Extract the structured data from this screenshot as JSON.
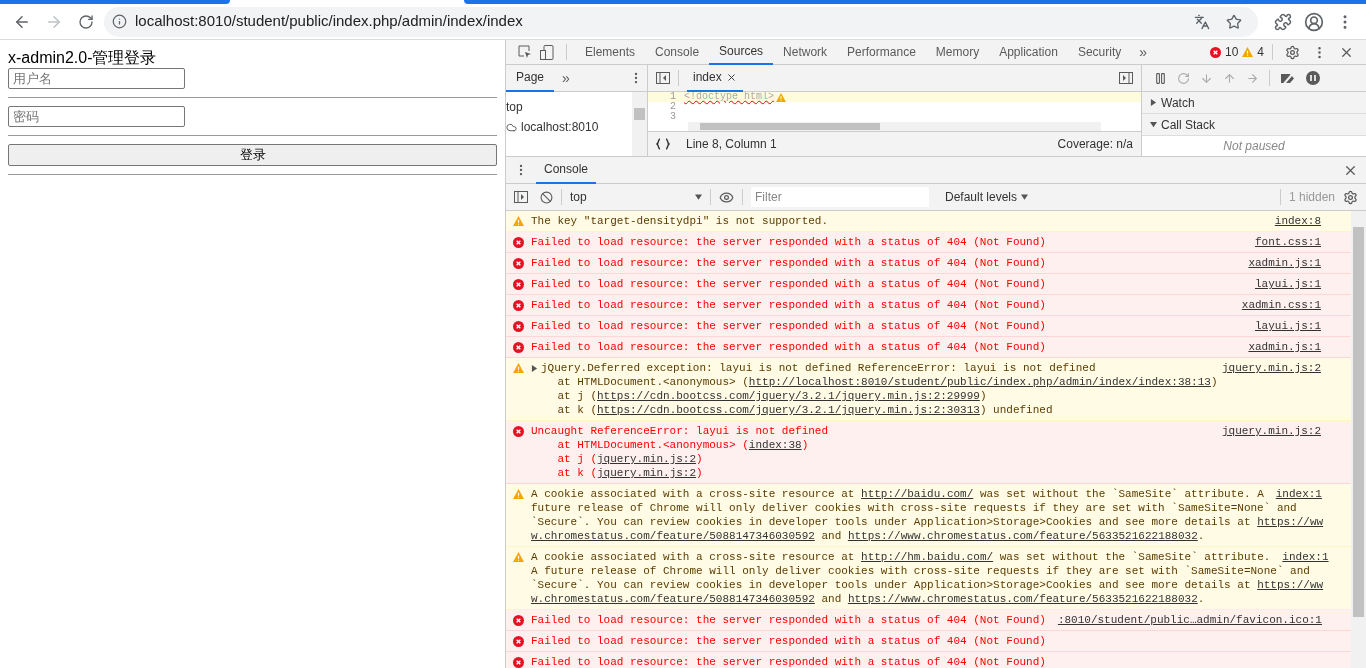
{
  "browser": {
    "url": "localhost:8010/student/public/index.php/admin/index/index",
    "forward_disabled": true
  },
  "page": {
    "title": "x-admin2.0-管理登录",
    "username_placeholder": "用户名",
    "password_placeholder": "密码",
    "login_button": "登录"
  },
  "devtools": {
    "tabs": [
      {
        "label": "Elements",
        "selected": false
      },
      {
        "label": "Console",
        "selected": false
      },
      {
        "label": "Sources",
        "selected": true
      },
      {
        "label": "Network",
        "selected": false
      },
      {
        "label": "Performance",
        "selected": false
      },
      {
        "label": "Memory",
        "selected": false
      },
      {
        "label": "Application",
        "selected": false
      },
      {
        "label": "Security",
        "selected": false
      }
    ],
    "more_tabs": "»",
    "error_count": "10",
    "warning_count": "4",
    "navigator": {
      "tabs": [
        {
          "label": "Page",
          "selected": true
        }
      ],
      "more": "»",
      "tree": [
        {
          "label": "top",
          "kind": "frame"
        },
        {
          "label": "localhost:8010",
          "kind": "origin"
        }
      ]
    },
    "editor": {
      "tabs": [
        {
          "label": "index",
          "selected": true
        }
      ],
      "lines": [
        {
          "number": "1",
          "code": "<!doctype html>",
          "warning": true
        },
        {
          "number": "2"
        },
        {
          "number": "3"
        }
      ],
      "status": "Line 8, Column 1",
      "coverage": "Coverage: n/a"
    },
    "debugger": {
      "sections": [
        {
          "label": "Watch",
          "expanded": false
        },
        {
          "label": "Call Stack",
          "expanded": true
        }
      ],
      "call_stack_text": "Not paused"
    },
    "drawer": {
      "tabs": [
        {
          "label": "Console",
          "selected": true
        }
      ],
      "context": "top",
      "filter_placeholder": "Filter",
      "levels": "Default levels",
      "hidden": "1 hidden",
      "messages": [
        {
          "kind": "warning",
          "source": "index:8",
          "lines": [
            [
              {
                "t": "The key \"target-densitydpi\" is not supported."
              }
            ]
          ]
        },
        {
          "kind": "error",
          "source": "font.css:1",
          "lines": [
            [
              {
                "t": "Failed to load resource: the server responded with a status of 404 (Not Found)"
              }
            ]
          ]
        },
        {
          "kind": "error",
          "source": "xadmin.js:1",
          "lines": [
            [
              {
                "t": "Failed to load resource: the server responded with a status of 404 (Not Found)"
              }
            ]
          ]
        },
        {
          "kind": "error",
          "source": "layui.js:1",
          "lines": [
            [
              {
                "t": "Failed to load resource: the server responded with a status of 404 (Not Found)"
              }
            ]
          ]
        },
        {
          "kind": "error",
          "source": "xadmin.css:1",
          "lines": [
            [
              {
                "t": "Failed to load resource: the server responded with a status of 404 (Not Found)"
              }
            ]
          ]
        },
        {
          "kind": "error",
          "source": "layui.js:1",
          "lines": [
            [
              {
                "t": "Failed to load resource: the server responded with a status of 404 (Not Found)"
              }
            ]
          ]
        },
        {
          "kind": "error",
          "source": "xadmin.js:1",
          "lines": [
            [
              {
                "t": "Failed to load resource: the server responded with a status of 404 (Not Found)"
              }
            ]
          ]
        },
        {
          "kind": "warning",
          "source": "jquery.min.js:2",
          "expanded": false,
          "lines": [
            [
              {
                "t": "jQuery.Deferred exception: layui is not defined ReferenceError: layui is not defined"
              }
            ],
            [
              {
                "t": "    at HTMLDocument.<anonymous> ("
              },
              {
                "t": "http://localhost:8010/student/public/index.php/admin/index/index:38:13",
                "link": true
              },
              {
                "t": ")"
              }
            ],
            [
              {
                "t": "    at j ("
              },
              {
                "t": "https://cdn.bootcss.com/jquery/3.2.1/jquery.min.js:2:29999",
                "link": true
              },
              {
                "t": ")"
              }
            ],
            [
              {
                "t": "    at k ("
              },
              {
                "t": "https://cdn.bootcss.com/jquery/3.2.1/jquery.min.js:2:30313",
                "link": true
              },
              {
                "t": ") undefined"
              }
            ]
          ]
        },
        {
          "kind": "error",
          "source": "jquery.min.js:2",
          "lines": [
            [
              {
                "t": "Uncaught ReferenceError: layui is not defined"
              }
            ],
            [
              {
                "t": "    at HTMLDocument.<anonymous> ("
              },
              {
                "t": "index:38",
                "link": true
              },
              {
                "t": ")"
              }
            ],
            [
              {
                "t": "    at j ("
              },
              {
                "t": "jquery.min.js:2",
                "link": true
              },
              {
                "t": ")"
              }
            ],
            [
              {
                "t": "    at k ("
              },
              {
                "t": "jquery.min.js:2",
                "link": true
              },
              {
                "t": ")"
              }
            ]
          ]
        },
        {
          "kind": "warning",
          "source": "index:1",
          "lines": [
            [
              {
                "t": "A cookie associated with a cross-site resource at "
              },
              {
                "t": "http://baidu.com/",
                "link": true
              },
              {
                "t": " was set without the `SameSite` attribute. A"
              }
            ],
            [
              {
                "t": "future release of Chrome will only deliver cookies with cross-site requests if they are set with `SameSite=None` and"
              }
            ],
            [
              {
                "t": "`Secure`. You can review cookies in developer tools under Application>Storage>Cookies and see more details at "
              },
              {
                "t": "https://ww",
                "link": true
              }
            ],
            [
              {
                "t": "w.chromestatus.com/feature/5088147346030592",
                "link": true
              },
              {
                "t": " and "
              },
              {
                "t": "https://www.chromestatus.com/feature/5633521622188032",
                "link": true
              },
              {
                "t": "."
              }
            ]
          ]
        },
        {
          "kind": "warning",
          "source": "index:1",
          "lines": [
            [
              {
                "t": "A cookie associated with a cross-site resource at "
              },
              {
                "t": "http://hm.baidu.com/",
                "link": true
              },
              {
                "t": " was set without the `SameSite` attribute."
              }
            ],
            [
              {
                "t": "A future release of Chrome will only deliver cookies with cross-site requests if they are set with `SameSite=None` and"
              }
            ],
            [
              {
                "t": "`Secure`. You can review cookies in developer tools under Application>Storage>Cookies and see more details at "
              },
              {
                "t": "https://ww",
                "link": true
              }
            ],
            [
              {
                "t": "w.chromestatus.com/feature/5088147346030592",
                "link": true
              },
              {
                "t": " and "
              },
              {
                "t": "https://www.chromestatus.com/feature/5633521622188032",
                "link": true
              },
              {
                "t": "."
              }
            ]
          ]
        },
        {
          "kind": "error",
          "source": ":8010/student/public…admin/favicon.ico:1",
          "lines": [
            [
              {
                "t": "Failed to load resource: the server responded with a status of 404 (Not Found)"
              }
            ]
          ]
        },
        {
          "kind": "error",
          "lines": [
            [
              {
                "t": "Failed to load resource: the server responded with a status of 404 (Not Found)"
              }
            ]
          ]
        },
        {
          "kind": "error",
          "lines": [
            [
              {
                "t": "Failed to load resource: the server responded with a status of 404 (Not Found)"
              }
            ]
          ]
        }
      ]
    }
  }
}
